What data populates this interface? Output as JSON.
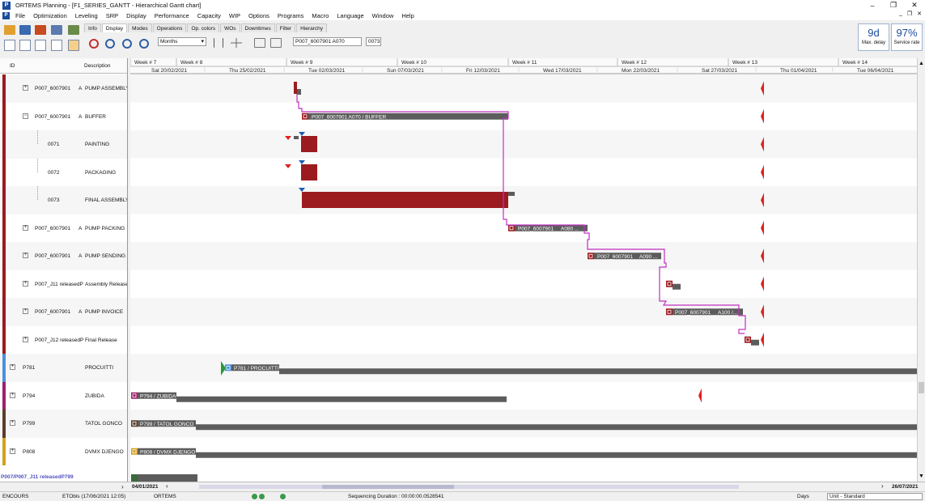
{
  "window": {
    "title": "ORTEMS  Planning - [F1_SERIES_GANTT - Hierarchical Gantt chart]",
    "app_letter": "P"
  },
  "menu": [
    "File",
    "Optimization",
    "Leveling",
    "SRP",
    "Display",
    "Performance",
    "Capacity",
    "WIP",
    "Options",
    "Programs",
    "Macro",
    "Language",
    "Window",
    "Help"
  ],
  "ribbon_tabs": [
    "Info",
    "Display",
    "Modes",
    "Operations",
    "Op. colors",
    "WOs",
    "Downtimes",
    "Filter",
    "Hierarchy"
  ],
  "active_tab": "Display",
  "toolbar": {
    "scale": "Months",
    "wo_input": "P007_6007901       A070",
    "op_input": "0073"
  },
  "kpis": {
    "max_delay": {
      "value": "9d",
      "label": "Max. delay"
    },
    "service_rate": {
      "value": "97%",
      "label": "Service rate"
    }
  },
  "grid": {
    "headers": {
      "id": "ID",
      "description": "Description"
    },
    "rows": [
      {
        "id": "P007_6007901",
        "ix": "A",
        "desc": "PUMP ASSEMBLY",
        "color": "#9b1b1f",
        "level": 1,
        "sign": "+"
      },
      {
        "id": "P007_6007901",
        "ix": "A",
        "desc": "BUFFER",
        "color": "#9b1b1f",
        "level": 1,
        "sign": "−"
      },
      {
        "id": "0071",
        "ix": "",
        "desc": "PAINTING",
        "color": "#9b1b1f",
        "level": 2,
        "sign": ""
      },
      {
        "id": "0072",
        "ix": "",
        "desc": "PACKAGING",
        "color": "#9b1b1f",
        "level": 2,
        "sign": ""
      },
      {
        "id": "0073",
        "ix": "",
        "desc": "FINAL ASSEMBLY",
        "color": "#9b1b1f",
        "level": 2,
        "sign": ""
      },
      {
        "id": "P007_6007901",
        "ix": "A",
        "desc": "PUMP PACKING",
        "color": "#9b1b1f",
        "level": 1,
        "sign": "+"
      },
      {
        "id": "P007_6007901",
        "ix": "A",
        "desc": "PUMP SENDING",
        "color": "#9b1b1f",
        "level": 1,
        "sign": "+"
      },
      {
        "id": "P007_J11 releasedP",
        "ix": "",
        "desc": "Assembly Release",
        "color": "#9b1b1f",
        "level": 1,
        "sign": "+"
      },
      {
        "id": "P007_6007901",
        "ix": "A",
        "desc": "PUMP INVOICE",
        "color": "#9b1b1f",
        "level": 1,
        "sign": "+"
      },
      {
        "id": "P007_J12 releasedP",
        "ix": "",
        "desc": "Final Release",
        "color": "#9b1b1f",
        "level": 1,
        "sign": "+"
      },
      {
        "id": "P781",
        "ix": "",
        "desc": "PROCUITTI",
        "color": "#4a90d9",
        "level": 0,
        "sign": "+"
      },
      {
        "id": "P794",
        "ix": "",
        "desc": "ZUBIDA",
        "color": "#a0206a",
        "level": 0,
        "sign": "+"
      },
      {
        "id": "P799",
        "ix": "",
        "desc": "TATOL GONCO",
        "color": "#5a3e2b",
        "level": 0,
        "sign": "+"
      },
      {
        "id": "P808",
        "ix": "",
        "desc": "DVMX DJENGO",
        "color": "#d4a020",
        "level": 0,
        "sign": "+"
      }
    ],
    "footer_path": "P007/P007_J11 releasedP799"
  },
  "gantt": {
    "weeks": [
      "Week # 7",
      "Week # 8",
      "Week # 9",
      "Week # 10",
      "Week # 11",
      "Week # 12",
      "Week # 13",
      "Week # 14"
    ],
    "dates": [
      "Sat 20/02/2021",
      "Thu 25/02/2021",
      "Tue 02/03/2021",
      "Sun 07/03/2021",
      "Fri 12/03/2021",
      "Wed 17/03/2021",
      "Mon 22/03/2021",
      "Sat 27/03/2021",
      "Thu 01/04/2021",
      "Tue 06/04/2021"
    ],
    "bar_labels": {
      "buffer": "P007_6007901       A070 / BUFFER",
      "packing_id": "P007_6007901",
      "packing_op": "A080 ...",
      "sending_id": "P007_6007901",
      "sending_op": "A090 ...",
      "invoice_id": "P007_6007901",
      "invoice_op": "A100 /...",
      "p781": "P781 / PROCUITTI",
      "p794": "P794 / ZUBIDA",
      "p799": "P799 / TATOL GONCO",
      "p808": "P808 / DVMX DJENGO"
    },
    "colors": {
      "work": "#9b1b1f",
      "queue": "#5c5c5c",
      "link": "#c030c0",
      "deadline": "#e02020",
      "blue_marker": "#1e5cb0",
      "green_marker": "#2a9a3a"
    }
  },
  "bottom": {
    "start_date": "04/01/2021",
    "end_date": "26/07/2021"
  },
  "status": {
    "mode": "ENCOURS",
    "etobis": "ETObis (17/06/2021 12:05)",
    "app": "ORTEMS",
    "duration": "Sequencing Duration : 00:00:00.0528541",
    "unit_label": "Days",
    "unit_select": "Unit - Standard"
  }
}
